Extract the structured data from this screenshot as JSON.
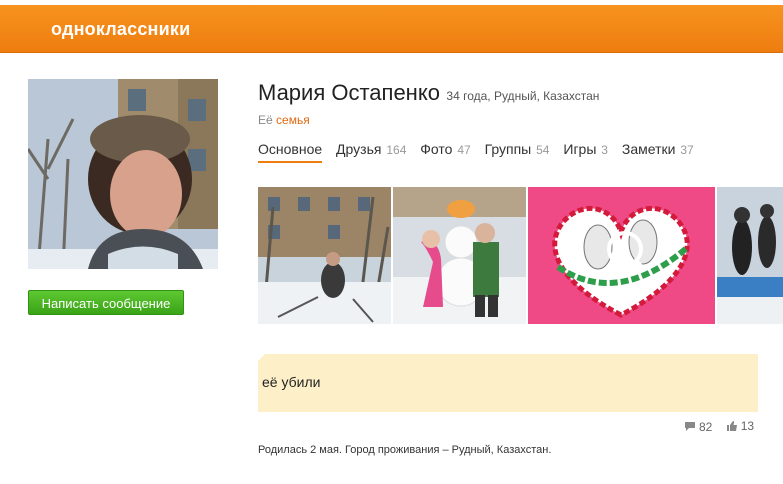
{
  "header": {
    "logo": "одноклассники"
  },
  "profile": {
    "name": "Мария Остапенко",
    "meta": "34 года, Рудный, Казахстан",
    "family_prefix": "Её",
    "family_link": "семья",
    "message_button": "Написать сообщение"
  },
  "tabs": [
    {
      "label": "Основное",
      "count": ""
    },
    {
      "label": "Друзья",
      "count": "164"
    },
    {
      "label": "Фото",
      "count": "47"
    },
    {
      "label": "Группы",
      "count": "54"
    },
    {
      "label": "Игры",
      "count": "3"
    },
    {
      "label": "Заметки",
      "count": "37"
    }
  ],
  "status": {
    "text": "её убили",
    "comments": "82",
    "likes": "13"
  },
  "bio": "Родилась 2 мая. Город проживания – Рудный, Казахстан.",
  "colors": {
    "brand": "#ee7d0f",
    "button": "#3aa317",
    "status_bg": "#fdf0c8",
    "link": "#e06a15"
  }
}
